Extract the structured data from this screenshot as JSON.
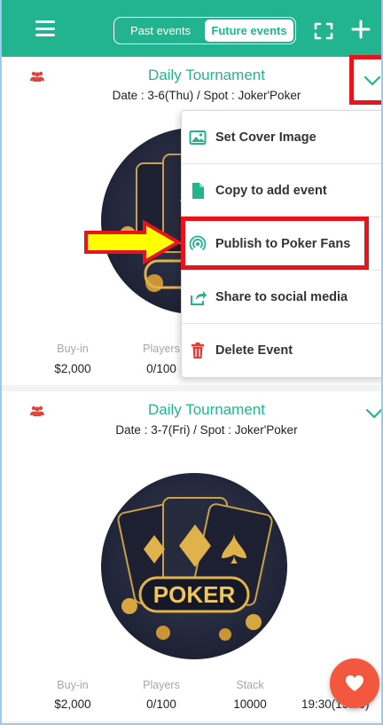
{
  "header": {
    "tabs": [
      {
        "label": "Past events",
        "active": false
      },
      {
        "label": "Future events",
        "active": true
      }
    ]
  },
  "events": [
    {
      "title": "Daily Tournament",
      "subtitle": "Date : 3-6(Thu) / Spot : Joker'Poker",
      "stats": {
        "buyin_label": "Buy-in",
        "buyin": "$2,000",
        "players_label": "Players",
        "players": "0/100"
      }
    },
    {
      "title": "Daily Tournament",
      "subtitle": "Date : 3-7(Fri) / Spot : Joker'Poker",
      "poster_text": "POKER",
      "stats": {
        "buyin_label": "Buy-in",
        "buyin": "$2,000",
        "players_label": "Players",
        "players": "0/100",
        "stack_label": "Stack",
        "stack": "10000",
        "time": "19:30(19:00)"
      }
    }
  ],
  "menu": {
    "items": [
      {
        "label": "Set Cover Image",
        "icon": "image-icon"
      },
      {
        "label": "Copy to add event",
        "icon": "document-icon"
      },
      {
        "label": "Publish to Poker Fans",
        "icon": "broadcast-icon"
      },
      {
        "label": "Share to social media",
        "icon": "share-icon"
      },
      {
        "label": "Delete Event",
        "icon": "trash-icon"
      }
    ]
  },
  "colors": {
    "brand": "#22b48e",
    "highlight": "#e8141b",
    "arrow": "#ffff00",
    "fab": "#f1583d",
    "delete": "#e53935"
  }
}
